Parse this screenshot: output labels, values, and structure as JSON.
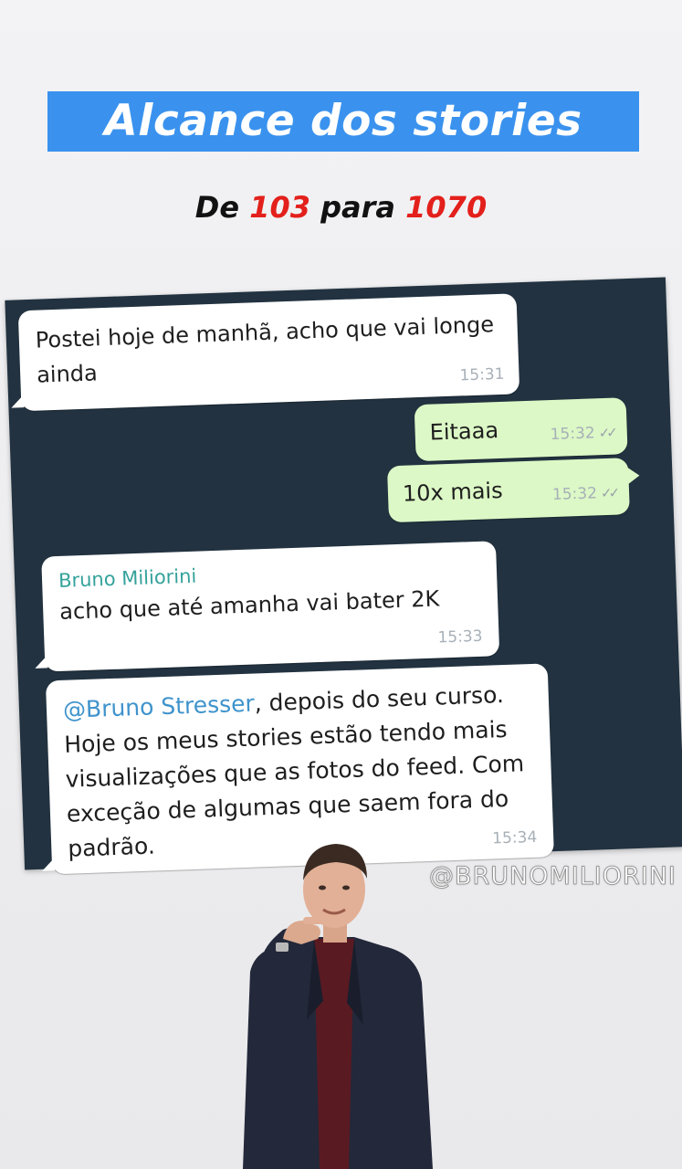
{
  "headline": {
    "title": "Alcance dos stories",
    "prefix": "De",
    "from_value": "103",
    "middle": "para",
    "to_value": "1070"
  },
  "chat": {
    "messages": [
      {
        "direction": "in",
        "text": "Postei hoje de manhã, acho que vai longe ainda",
        "time": "15:31"
      },
      {
        "direction": "out",
        "text": "Eitaaa",
        "time": "15:32",
        "ticks": "✓✓"
      },
      {
        "direction": "out",
        "text": "10x mais",
        "time": "15:32",
        "ticks": "✓✓"
      },
      {
        "direction": "in",
        "sender": "Bruno Miliorini",
        "text": "acho que até amanha vai bater 2K",
        "time": "15:33"
      },
      {
        "direction": "in",
        "mention": "@Bruno Stresser",
        "text": ", depois do seu curso. Hoje os meus stories estão tendo mais visualizações que as fotos do feed. Com exceção de algumas que saem fora do padrão.",
        "time": "15:34"
      }
    ]
  },
  "watermark": "@BRUNOMILIORINI",
  "colors": {
    "headline_bg": "#3a92ee",
    "highlight": "#e3201b",
    "chat_bg": "#223240",
    "outgoing_bubble": "#dcf8c6",
    "incoming_bubble": "#ffffff",
    "sender_name": "#35a29b",
    "mention": "#3f93cc"
  },
  "icons": {
    "read_receipt": "double-check-icon",
    "presenter": "person-pointing-figure"
  }
}
